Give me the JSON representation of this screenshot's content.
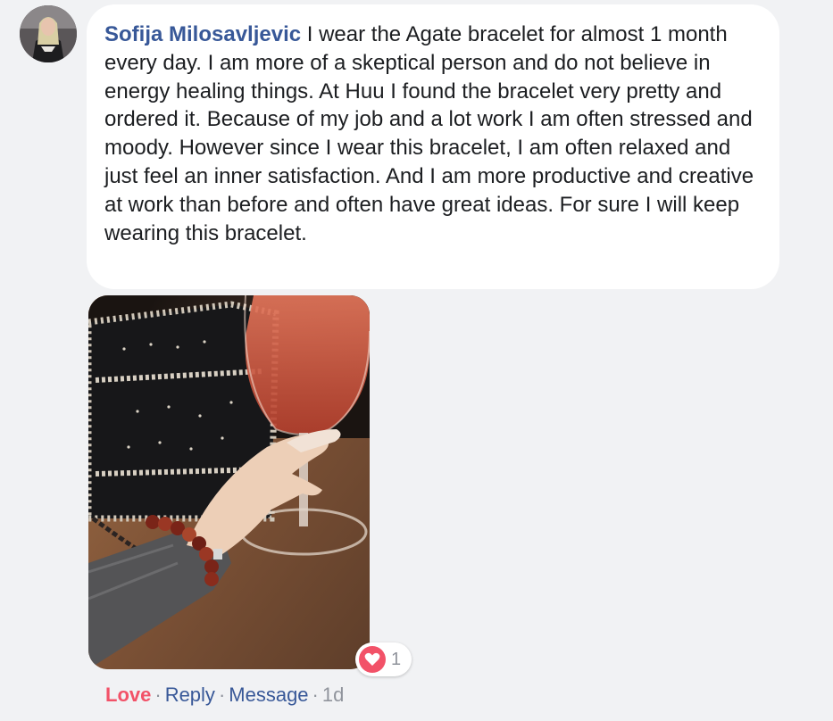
{
  "comment": {
    "author": "Sofija Milosavljevic",
    "text": " I wear the Agate bracelet for almost 1 month every day. I am more of a skeptical person and do not believe in energy healing things. At Huu I found the bracelet very pretty and ordered it. Because of my job and a lot work I am often stressed and moody. However since I wear this bracelet, I am often relaxed and just feel an inner satisfaction. And I am more productive and creative at work than before and often have great ideas. For sure I will keep wearing this bracelet."
  },
  "reaction": {
    "icon": "heart-icon",
    "count": "1",
    "color": "#f25268"
  },
  "actions": {
    "love_label": "Love",
    "separator": "·",
    "reply_label": "Reply",
    "message_label": "Message",
    "timestamp": "1d"
  },
  "colors": {
    "author": "#385898",
    "love": "#f25268",
    "muted": "#90949c",
    "background": "#f1f2f4",
    "bubble": "#ffffff"
  }
}
